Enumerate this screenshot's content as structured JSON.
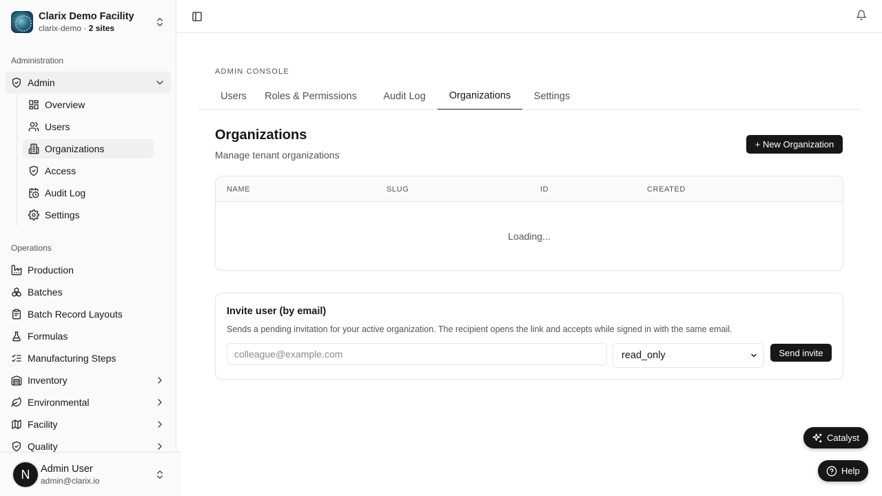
{
  "org": {
    "name": "Clarix Demo Facility",
    "slug": "clarix-demo",
    "separator": " · ",
    "sites": "2 sites"
  },
  "sidebar": {
    "group_admin": "Administration",
    "admin_label": "Admin",
    "admin_children": [
      {
        "label": "Overview",
        "icon": "dashboard-icon"
      },
      {
        "label": "Users",
        "icon": "users-icon"
      },
      {
        "label": "Organizations",
        "icon": "building-icon"
      },
      {
        "label": "Access",
        "icon": "shield-check-icon"
      },
      {
        "label": "Audit Log",
        "icon": "calendar-clock-icon"
      },
      {
        "label": "Settings",
        "icon": "gear-icon"
      }
    ],
    "group_ops": "Operations",
    "ops_items": [
      {
        "label": "Production",
        "icon": "factory-icon"
      },
      {
        "label": "Batches",
        "icon": "boxes-icon"
      },
      {
        "label": "Batch Record Layouts",
        "icon": "clipboard-icon"
      },
      {
        "label": "Formulas",
        "icon": "flask-icon"
      },
      {
        "label": "Manufacturing Steps",
        "icon": "list-checks-icon"
      },
      {
        "label": "Inventory",
        "icon": "warehouse-icon"
      },
      {
        "label": "Environmental",
        "icon": "leaf-icon"
      },
      {
        "label": "Facility",
        "icon": "map-icon"
      },
      {
        "label": "Quality",
        "icon": "shield-check-icon"
      }
    ]
  },
  "user": {
    "initial": "N",
    "name": "Admin User",
    "email": "admin@clarix.io"
  },
  "main": {
    "console_label": "ADMIN CONSOLE",
    "tabs": [
      "Users",
      "Roles & Permissions",
      "Audit Log",
      "Organizations",
      "Settings"
    ],
    "active_tab": "Organizations",
    "title": "Organizations",
    "subtitle": "Manage tenant organizations",
    "new_button": "+ New Organization",
    "table": {
      "columns": [
        "NAME",
        "SLUG",
        "ID",
        "CREATED"
      ],
      "loading_text": "Loading..."
    },
    "invite": {
      "title": "Invite user (by email)",
      "description": "Sends a pending invitation for your active organization. The recipient opens the link and accepts while signed in with the same email.",
      "email_placeholder": "colleague@example.com",
      "email_value": "",
      "role_value": "read_only",
      "send_label": "Send invite"
    }
  },
  "floating": {
    "catalyst_label": "Catalyst",
    "help_label": "Help"
  }
}
